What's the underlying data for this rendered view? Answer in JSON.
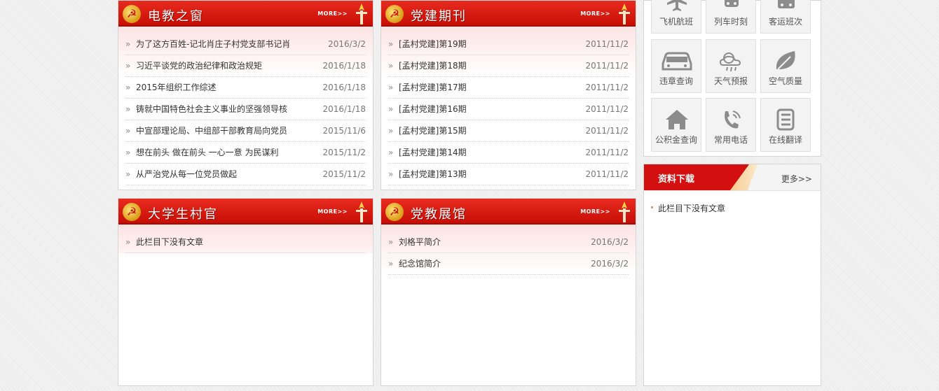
{
  "panels": {
    "dianjiao": {
      "title": "电教之窗",
      "more": "MORE>>",
      "items": [
        {
          "text": "为了这方百姓-记北肖庄子村党支部书记肖",
          "date": "2016/3/2"
        },
        {
          "text": "习近平谈党的政治纪律和政治规矩",
          "date": "2016/1/18"
        },
        {
          "text": "2015年组织工作综述",
          "date": "2016/1/18"
        },
        {
          "text": "铸就中国特色社会主义事业的坚强领导核",
          "date": "2016/1/18"
        },
        {
          "text": "中宣部理论局、中组部干部教育局向党员",
          "date": "2015/11/6"
        },
        {
          "text": "想在前头 做在前头 一心一意 为民谋利",
          "date": "2015/11/2"
        },
        {
          "text": "从严治党从每一位党员做起",
          "date": "2015/11/2"
        }
      ]
    },
    "dangjian": {
      "title": "党建期刊",
      "more": "MORE>>",
      "items": [
        {
          "text": "[孟村党建]第19期",
          "date": "2011/11/2"
        },
        {
          "text": "[孟村党建]第18期",
          "date": "2011/11/2"
        },
        {
          "text": "[孟村党建]第17期",
          "date": "2011/11/2"
        },
        {
          "text": "[孟村党建]第16期",
          "date": "2011/11/2"
        },
        {
          "text": "[孟村党建]第15期",
          "date": "2011/11/2"
        },
        {
          "text": "[孟村党建]第14期",
          "date": "2011/11/2"
        },
        {
          "text": "[孟村党建]第13期",
          "date": "2011/11/2"
        }
      ]
    },
    "cunguan": {
      "title": "大学生村官",
      "more": "MORE>>",
      "items": [
        {
          "text": "此栏目下没有文章",
          "date": ""
        }
      ]
    },
    "zhanguan": {
      "title": "党教展馆",
      "more": "MORE>>",
      "items": [
        {
          "text": "刘格平简介",
          "date": "2016/3/2"
        },
        {
          "text": "纪念馆简介",
          "date": "2016/3/2"
        }
      ]
    }
  },
  "services": [
    {
      "label": "飞机航班",
      "icon": "airplane-icon"
    },
    {
      "label": "列车时刻",
      "icon": "train-icon"
    },
    {
      "label": "客运班次",
      "icon": "bus-icon"
    },
    {
      "label": "违章查询",
      "icon": "car-icon"
    },
    {
      "label": "天气预报",
      "icon": "weather-icon"
    },
    {
      "label": "空气质量",
      "icon": "leaf-icon"
    },
    {
      "label": "公积金查询",
      "icon": "house-icon"
    },
    {
      "label": "常用电话",
      "icon": "phone-icon"
    },
    {
      "label": "在线翻译",
      "icon": "translate-icon"
    }
  ],
  "download": {
    "title": "资料下载",
    "more": "更多>>",
    "empty_text": "此栏目下没有文章"
  },
  "colors": {
    "header_red": "#d40f0f",
    "tile_bg": "#f3f3f3",
    "icon_gray": "#8c8c8c"
  }
}
